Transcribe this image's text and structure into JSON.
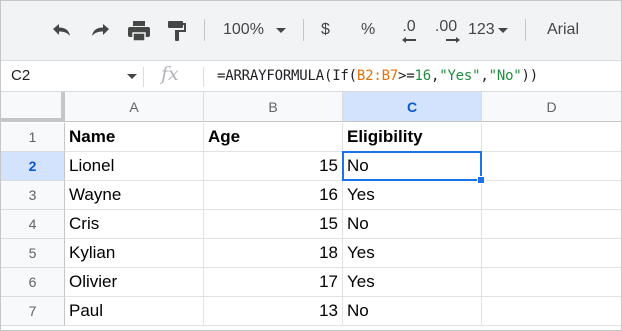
{
  "toolbar": {
    "undo_icon": "undo-icon",
    "redo_icon": "redo-icon",
    "print_icon": "print-icon",
    "paint_format_icon": "paint-format-icon",
    "zoom": "100%",
    "currency": "$",
    "percent": "%",
    "decrease_decimal": ".0",
    "increase_decimal": ".00",
    "more_formats": "123",
    "font": "Arial"
  },
  "formula_bar": {
    "name_box": "C2",
    "fx_label": "fx",
    "formula_parts": {
      "prefix": "=ARRAYFORMULA(If(",
      "range": "B2:B7",
      "op": ">=",
      "num": "16",
      "comma1": ",",
      "yes": "\"Yes\"",
      "comma2": ",",
      "no": "\"No\"",
      "suffix": "))"
    }
  },
  "columns": [
    "A",
    "B",
    "C",
    "D"
  ],
  "rows": [
    "1",
    "2",
    "3",
    "4",
    "5",
    "6",
    "7"
  ],
  "headers": {
    "a": "Name",
    "b": "Age",
    "c": "Eligibility"
  },
  "data": [
    {
      "name": "Lionel",
      "age": "15",
      "eligibility": "No"
    },
    {
      "name": "Wayne",
      "age": "16",
      "eligibility": "Yes"
    },
    {
      "name": "Cris",
      "age": "15",
      "eligibility": "No"
    },
    {
      "name": "Kylian",
      "age": "18",
      "eligibility": "Yes"
    },
    {
      "name": "Olivier",
      "age": "17",
      "eligibility": "Yes"
    },
    {
      "name": "Paul",
      "age": "13",
      "eligibility": "No"
    }
  ],
  "colors": {
    "accent": "#1a73e8",
    "header_selected": "#d3e3fd"
  }
}
